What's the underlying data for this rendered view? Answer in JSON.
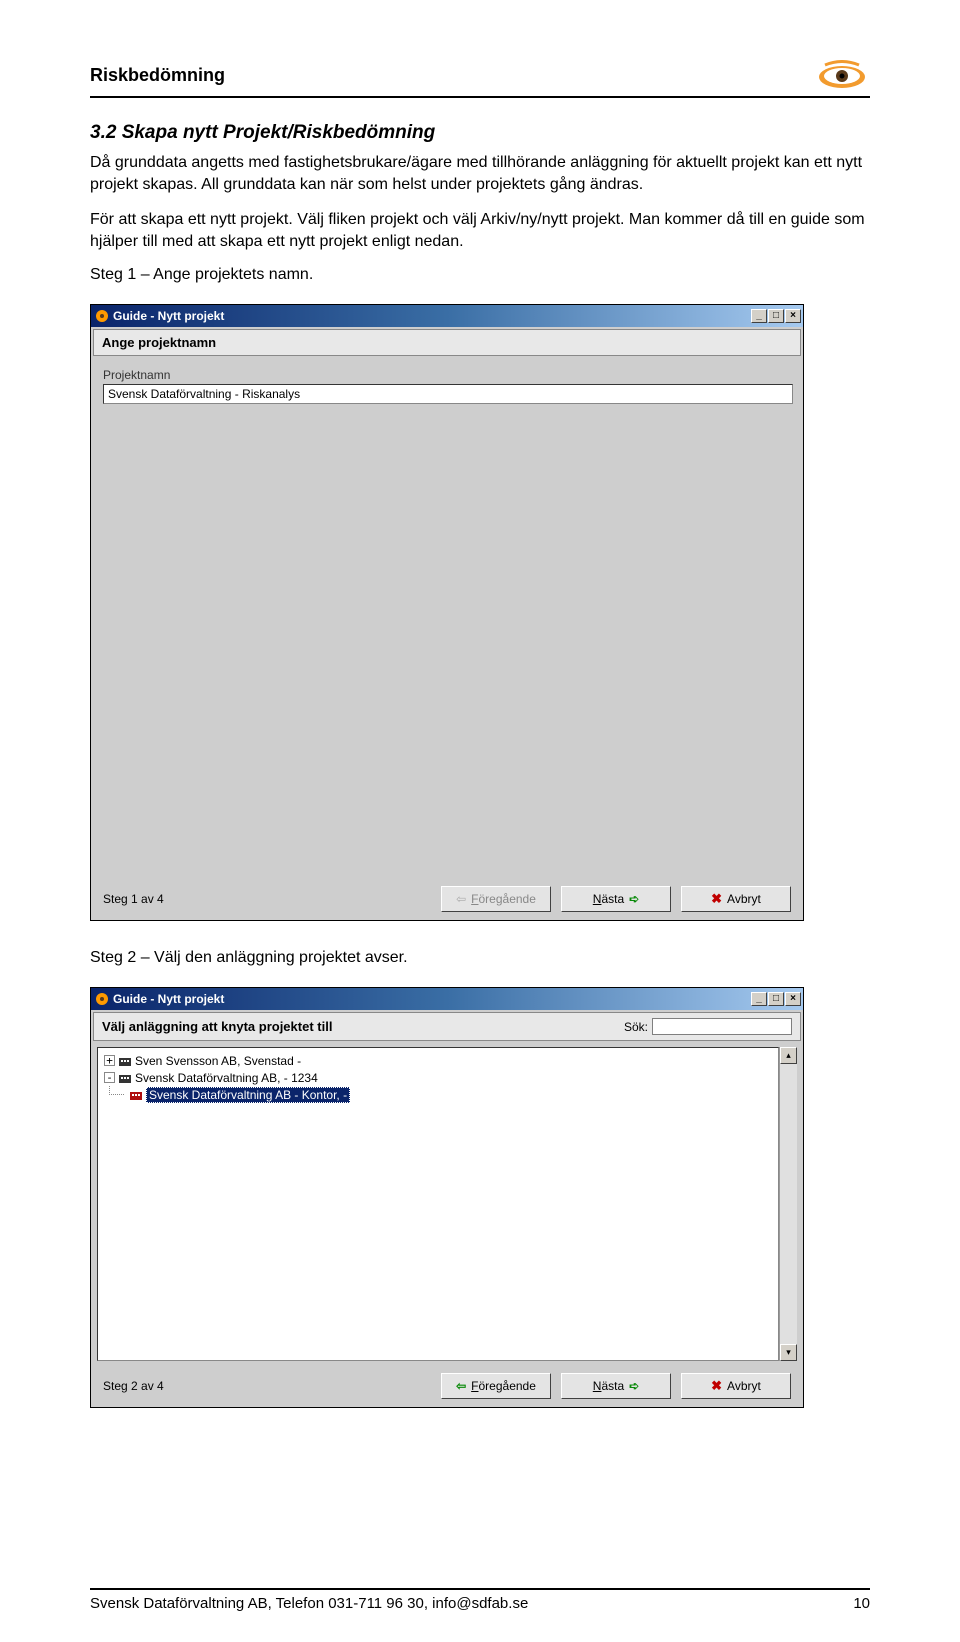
{
  "header": {
    "title": "Riskbedömning"
  },
  "section": {
    "heading": "3.2 Skapa nytt Projekt/Riskbedömning",
    "paragraph1": "Då grunddata angetts med fastighetsbrukare/ägare med tillhörande anläggning för aktuellt projekt kan ett nytt projekt skapas. All grunddata kan när som helst under projektets gång ändras.",
    "paragraph2": "För att skapa ett nytt projekt. Välj fliken projekt och välj Arkiv/ny/nytt projekt. Man kommer då till en guide som hjälper till med att skapa ett nytt projekt enligt nedan.",
    "step1_label": "Steg 1 – Ange projektets namn.",
    "step2_label": "Steg 2 – Välj den anläggning projektet avser."
  },
  "dialog1": {
    "title": "Guide - Nytt projekt",
    "banner": "Ange projektnamn",
    "field_label": "Projektnamn",
    "field_value": "Svensk Dataförvaltning - Riskanalys",
    "step_text": "Steg 1 av 4",
    "btn_prev": "Föregående",
    "btn_next": "Nästa",
    "btn_cancel": "Avbryt"
  },
  "dialog2": {
    "title": "Guide - Nytt projekt",
    "banner": "Välj anläggning att knyta projektet till",
    "search_label": "Sök:",
    "search_value": "",
    "tree": {
      "n1": "Sven Svensson AB, Svenstad -",
      "n2": "Svensk Dataförvaltning AB,  - 1234",
      "n3": "Svensk Dataförvaltning AB - Kontor,  -"
    },
    "step_text": "Steg 2 av 4",
    "btn_prev": "Föregående",
    "btn_next": "Nästa",
    "btn_cancel": "Avbryt"
  },
  "footer": {
    "text": "Svensk Dataförvaltning AB, Telefon 031-711 96 30, info@sdfab.se",
    "page": "10"
  }
}
